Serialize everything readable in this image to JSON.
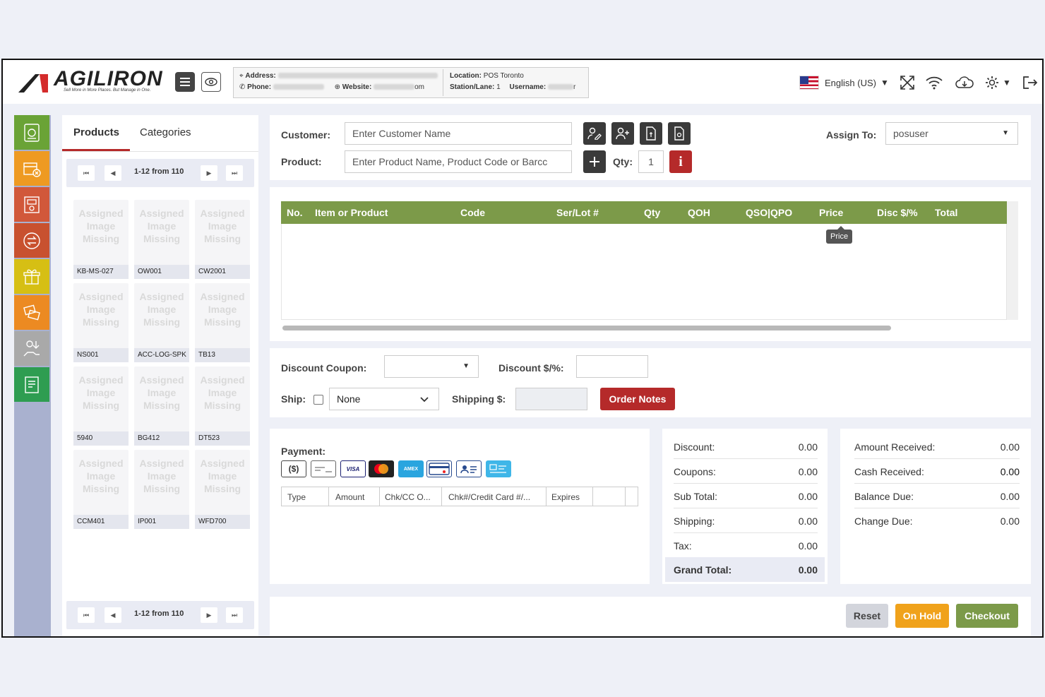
{
  "header": {
    "brand": "AGILIRON",
    "tagline": "Sell More in More Places. But Manage in One.",
    "address_label": "Address:",
    "phone_label": "Phone:",
    "website_label": "Website:",
    "website_suffix": "om",
    "location_label": "Location:",
    "location_value": "POS Toronto",
    "station_label": "Station/Lane:",
    "station_value": "1",
    "username_label": "Username:",
    "username_suffix": "r",
    "language": "English (US)"
  },
  "sidebar": {
    "items": [
      {
        "icon": "pos-terminal-icon",
        "color": "#6aa336"
      },
      {
        "icon": "cancel-receipt-icon",
        "color": "#ee9a22"
      },
      {
        "icon": "register-icon",
        "color": "#d1583a"
      },
      {
        "icon": "exchange-icon",
        "color": "#c8512f"
      },
      {
        "icon": "gift-icon",
        "color": "#d6bf14"
      },
      {
        "icon": "tickets-icon",
        "color": "#ec8a22"
      },
      {
        "icon": "cash-out-icon",
        "color": "#a9a9a9"
      },
      {
        "icon": "report-icon",
        "color": "#2e9d51"
      }
    ]
  },
  "products": {
    "tabs": [
      "Products",
      "Categories"
    ],
    "pager_text": "1-12 from 110",
    "missing_text": [
      "Assigned",
      "Image",
      "Missing"
    ],
    "items": [
      "KB-MS-027",
      "OW001",
      "CW2001",
      "NS001",
      "ACC-LOG-SPK",
      "TB13",
      "5940",
      "BG412",
      "DT523",
      "CCM401",
      "IP001",
      "WFD700"
    ]
  },
  "order": {
    "customer_label": "Customer:",
    "customer_placeholder": "Enter Customer Name",
    "product_label": "Product:",
    "product_placeholder": "Enter Product Name, Product Code or Barcc",
    "qty_label": "Qty:",
    "qty_value": "1",
    "assign_label": "Assign To:",
    "assign_value": "posuser"
  },
  "grid": {
    "columns": [
      "No.",
      "Item or Product",
      "Code",
      "Ser/Lot #",
      "Qty",
      "QOH",
      "QSO|QPO",
      "Price",
      "Disc $/%",
      "Total"
    ],
    "tooltip": "Price"
  },
  "discount": {
    "coupon_label": "Discount Coupon:",
    "discount_label": "Discount $/%:",
    "ship_label": "Ship:",
    "ship_option": "None",
    "shipping_label": "Shipping $:",
    "order_notes": "Order Notes"
  },
  "payment": {
    "label": "Payment:",
    "columns": [
      "Type",
      "Amount",
      "Chk/CC O...",
      "Chk#/Credit Card #/...",
      "Expires"
    ]
  },
  "totals": [
    {
      "label": "Discount:",
      "value": "0.00"
    },
    {
      "label": "Coupons:",
      "value": "0.00"
    },
    {
      "label": "Sub Total:",
      "value": "0.00"
    },
    {
      "label": "Shipping:",
      "value": "0.00"
    },
    {
      "label": "Tax:",
      "value": "0.00"
    },
    {
      "label": "Grand Total:",
      "value": "0.00"
    }
  ],
  "received": [
    {
      "label": "Amount Received:",
      "value": "0.00"
    },
    {
      "label": "Cash Received:",
      "value": "0.00"
    },
    {
      "label": "Balance Due:",
      "value": "0.00"
    },
    {
      "label": "Change Due:",
      "value": "0.00"
    }
  ],
  "actions": {
    "reset": "Reset",
    "hold": "On Hold",
    "checkout": "Checkout"
  },
  "colors": {
    "green": "#7c9a49",
    "red": "#b52a2a",
    "orange": "#f0a21b",
    "gray": "#d3d5dc"
  }
}
